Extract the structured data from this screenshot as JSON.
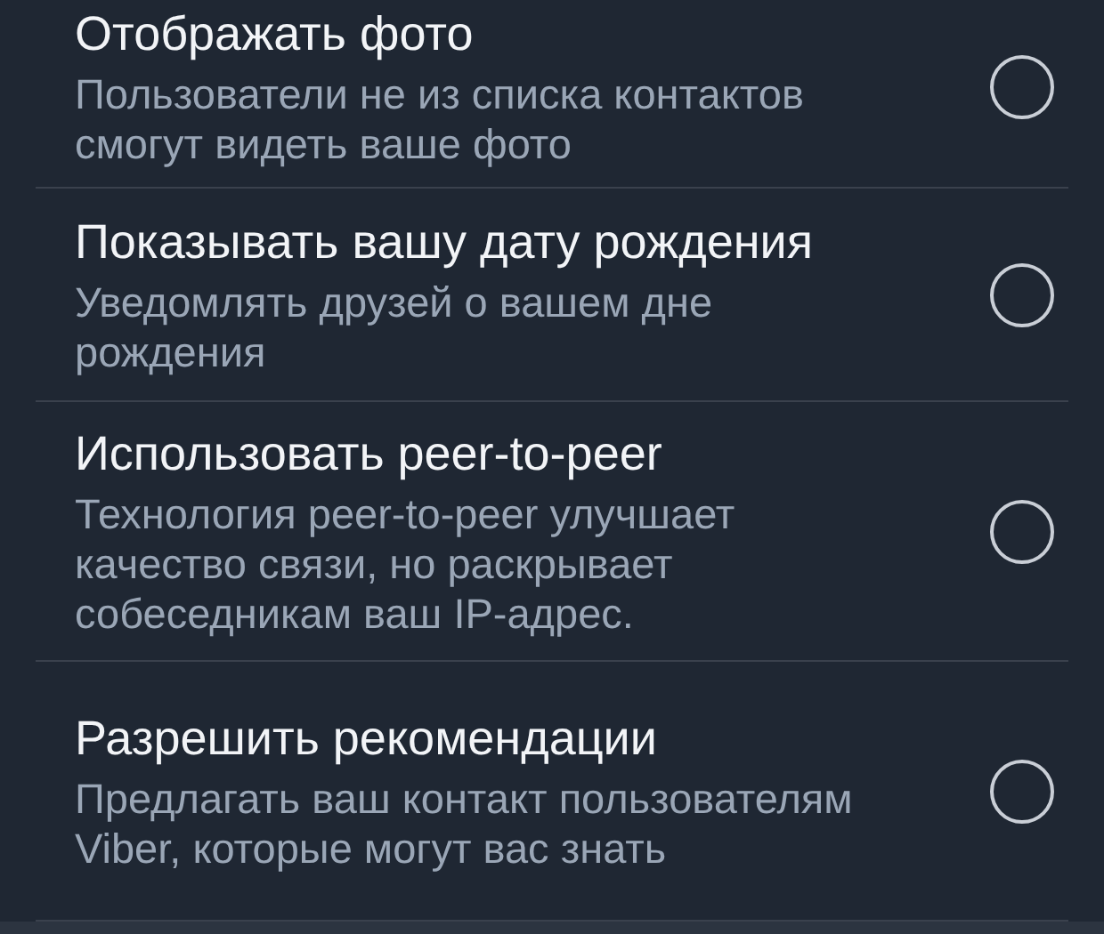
{
  "settings": [
    {
      "title": "Отображать фото",
      "description": "Пользователи не из списка контактов смогут видеть ваше фото",
      "checked": false
    },
    {
      "title": "Показывать вашу дату рождения",
      "description": "Уведомлять друзей о вашем дне рождения",
      "checked": false
    },
    {
      "title": "Использовать peer-to-peer",
      "description": "Технология peer-to-peer улучшает качество связи, но раскрывает собеседникам ваш IP-адрес.",
      "checked": false
    },
    {
      "title": "Разрешить рекомендации",
      "description": "Предлагать ваш контакт пользователям Viber, которые могут вас знать",
      "checked": false
    }
  ]
}
